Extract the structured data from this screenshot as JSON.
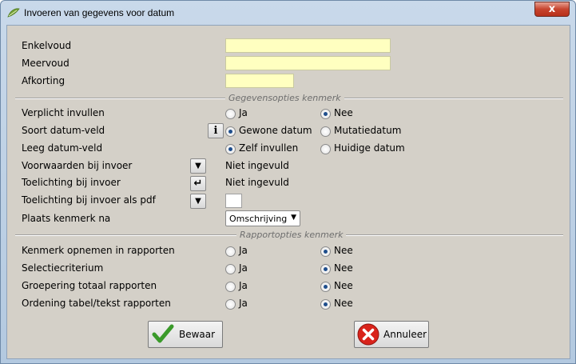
{
  "window": {
    "title": "Invoeren van gegevens voor datum",
    "close_glyph": "x"
  },
  "fields": {
    "enkelvoud_label": "Enkelvoud",
    "meervoud_label": "Meervoud",
    "afkorting_label": "Afkorting",
    "enkelvoud_value": "",
    "meervoud_value": "",
    "afkorting_value": ""
  },
  "section_data": {
    "title": "Gegevensopties kenmerk",
    "rows": [
      {
        "label": "Verplicht invullen",
        "opt1": "Ja",
        "opt2": "Nee",
        "selected": "Nee"
      },
      {
        "label": "Soort datum-veld",
        "opt1": "Gewone datum",
        "opt2": "Mutatiedatum",
        "selected": "Gewone datum"
      },
      {
        "label": "Leeg datum-veld",
        "opt1": "Zelf invullen",
        "opt2": "Huidige datum",
        "selected": "Zelf invullen"
      }
    ],
    "voorwaarden_label": "Voorwaarden bij invoer",
    "voorwaarden_value": "Niet ingevuld",
    "toelichting_label": "Toelichting bij invoer",
    "toelichting_value": "Niet ingevuld",
    "toelichting_pdf_label": "Toelichting bij invoer als pdf",
    "plaats_label": "Plaats kenmerk na",
    "plaats_value": "Omschrijving"
  },
  "section_report": {
    "title": "Rapportopties kenmerk",
    "rows": [
      {
        "label": "Kenmerk opnemen in rapporten",
        "opt1": "Ja",
        "opt2": "Nee",
        "selected": "Nee"
      },
      {
        "label": "Selectiecriterium",
        "opt1": "Ja",
        "opt2": "Nee",
        "selected": "Nee"
      },
      {
        "label": "Groepering totaal rapporten",
        "opt1": "Ja",
        "opt2": "Nee",
        "selected": "Nee"
      },
      {
        "label": "Ordening tabel/tekst rapporten",
        "opt1": "Ja",
        "opt2": "Nee",
        "selected": "Nee"
      }
    ]
  },
  "buttons": {
    "save_label": "Bewaar",
    "cancel_label": "Annuleer"
  },
  "icons": {
    "info_glyph": "i",
    "dropdown_glyph": "▼",
    "enter_glyph": "↵"
  },
  "colors": {
    "field_yellow": "#ffffc0",
    "save_green": "#3a9a2a",
    "cancel_red": "#d9231b"
  }
}
